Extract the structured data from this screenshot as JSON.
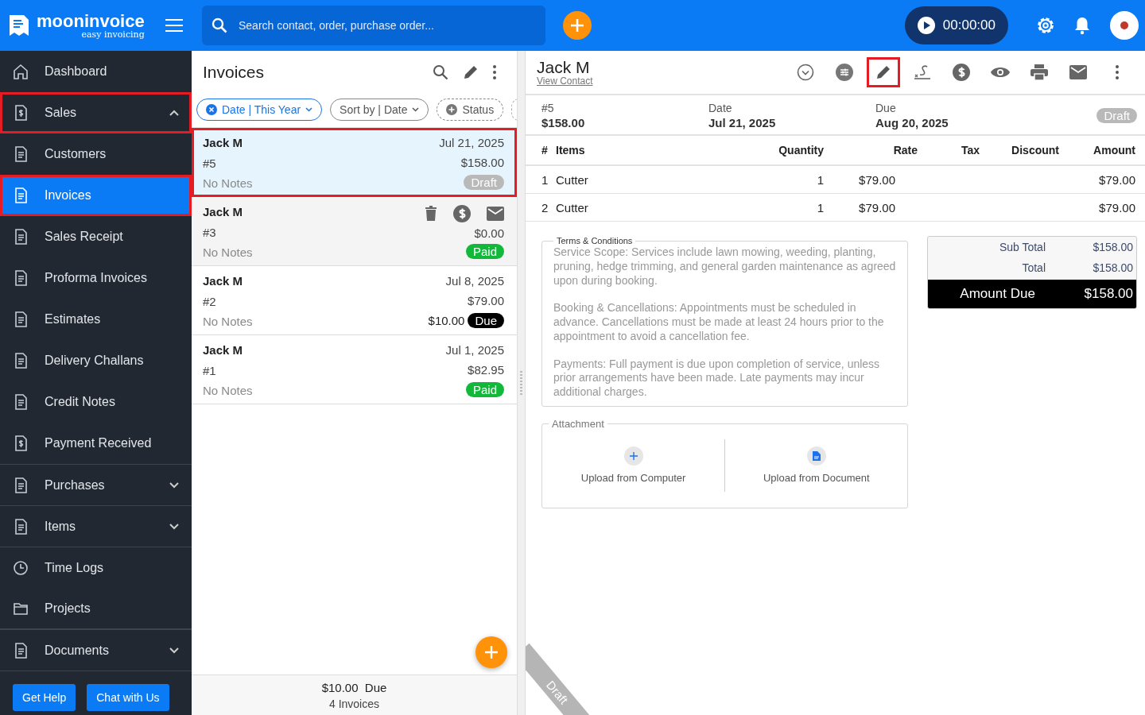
{
  "brand": {
    "name": "mooninvoice",
    "tagline": "easy invoicing"
  },
  "search": {
    "placeholder": "Search contact, order, purchase order..."
  },
  "timer": {
    "reading": "00:00:00"
  },
  "sidebar": {
    "items": [
      {
        "label": "Dashboard",
        "kind": "link",
        "selected": false,
        "highlighted": false
      },
      {
        "label": "Sales",
        "kind": "group",
        "expanded": true,
        "selected": false,
        "highlighted": true
      },
      {
        "label": "Customers",
        "kind": "link",
        "selected": false,
        "highlighted": false
      },
      {
        "label": "Invoices",
        "kind": "link",
        "selected": true,
        "highlighted": true
      },
      {
        "label": "Sales Receipt",
        "kind": "link",
        "selected": false,
        "highlighted": false
      },
      {
        "label": "Proforma Invoices",
        "kind": "link",
        "selected": false,
        "highlighted": false
      },
      {
        "label": "Estimates",
        "kind": "link",
        "selected": false,
        "highlighted": false
      },
      {
        "label": "Delivery Challans",
        "kind": "link",
        "selected": false,
        "highlighted": false
      },
      {
        "label": "Credit Notes",
        "kind": "link",
        "selected": false,
        "highlighted": false
      },
      {
        "label": "Payment Received",
        "kind": "link",
        "selected": false,
        "highlighted": false
      },
      {
        "label": "Purchases",
        "kind": "group",
        "expanded": false,
        "selected": false,
        "highlighted": false
      },
      {
        "label": "Items",
        "kind": "group",
        "expanded": false,
        "selected": false,
        "highlighted": false
      },
      {
        "label": "Time Logs",
        "kind": "link",
        "selected": false,
        "highlighted": false
      },
      {
        "label": "Projects",
        "kind": "link",
        "selected": false,
        "highlighted": false
      },
      {
        "label": "Documents",
        "kind": "group",
        "expanded": false,
        "selected": false,
        "highlighted": false
      }
    ],
    "buttons": [
      "Get Help",
      "Chat with Us"
    ]
  },
  "list": {
    "title": "Invoices",
    "filters": [
      {
        "label": "Date | This Year",
        "kind": "active"
      },
      {
        "label": "Sort by | Date",
        "kind": "sort"
      },
      {
        "label": "Status",
        "kind": "add"
      }
    ],
    "rows": [
      {
        "name": "Jack M",
        "number": "#5",
        "date": "Jul 21, 2025",
        "amount": "$158.00",
        "notes": "No Notes",
        "status": {
          "label": "Draft",
          "kind": "draft"
        },
        "selected": true,
        "highlighted": true,
        "hovered": false
      },
      {
        "name": "Jack M",
        "number": "#3",
        "amount": "$0.00",
        "notes": "No Notes",
        "status": {
          "label": "Paid",
          "kind": "paid"
        },
        "selected": false,
        "highlighted": false,
        "hovered": true
      },
      {
        "name": "Jack M",
        "number": "#2",
        "date": "Jul 8, 2025",
        "amount": "$79.00",
        "due_amount": "$10.00",
        "notes": "No Notes",
        "status": {
          "label": "Due",
          "kind": "due"
        },
        "selected": false,
        "highlighted": false,
        "hovered": false
      },
      {
        "name": "Jack M",
        "number": "#1",
        "date": "Jul 1, 2025",
        "amount": "$82.95",
        "notes": "No Notes",
        "status": {
          "label": "Paid",
          "kind": "paid"
        },
        "selected": false,
        "highlighted": false,
        "hovered": false
      }
    ],
    "footer": {
      "due_amount": "$10.00",
      "due_label": "Due",
      "count": "4 Invoices"
    }
  },
  "detail": {
    "customer": "Jack M",
    "contact_link": "View Contact",
    "toolbar": [
      {
        "kind": "status",
        "highlighted": false
      },
      {
        "kind": "adjust",
        "highlighted": false
      },
      {
        "kind": "edit",
        "highlighted": true
      },
      {
        "kind": "sign",
        "highlighted": false
      },
      {
        "kind": "payment",
        "highlighted": false
      },
      {
        "kind": "preview",
        "highlighted": false
      },
      {
        "kind": "print",
        "highlighted": false
      },
      {
        "kind": "email",
        "highlighted": false
      },
      {
        "kind": "more",
        "highlighted": false
      }
    ],
    "number": "#5",
    "total": "$158.00",
    "date_label": "Date",
    "date": "Jul 21, 2025",
    "due_label": "Due",
    "due": "Aug 20, 2025",
    "status": {
      "label": "Draft",
      "kind": "draft"
    },
    "table": {
      "columns": [
        "#",
        "Items",
        "Quantity",
        "Rate",
        "Tax",
        "Discount",
        "Amount"
      ],
      "rows": [
        [
          "1",
          "Cutter",
          "1",
          "$79.00",
          "",
          "",
          "$79.00"
        ],
        [
          "2",
          "Cutter",
          "1",
          "$79.00",
          "",
          "",
          "$79.00"
        ]
      ]
    },
    "terms": {
      "title": "Terms & Conditions",
      "paragraphs": [
        "Service Scope: Services include lawn mowing, weeding, planting, pruning, hedge trimming, and general garden maintenance as agreed upon during booking.",
        "Booking & Cancellations: Appointments must be scheduled in advance. Cancellations must be made at least 24 hours prior to the appointment to avoid a cancellation fee.",
        "Payments: Full payment is due upon completion of service, unless prior arrangements have been made. Late payments may incur additional charges."
      ]
    },
    "totals": [
      {
        "label": "Sub Total",
        "value": "$158.00"
      },
      {
        "label": "Total",
        "value": "$158.00"
      }
    ],
    "amount_due": {
      "label": "Amount Due",
      "value": "$158.00"
    },
    "attachment": {
      "title": "Attachment",
      "options": [
        {
          "label": "Upload from Computer",
          "kind": "computer"
        },
        {
          "label": "Upload from Document",
          "kind": "document"
        }
      ]
    },
    "ribbon": "Draft"
  }
}
